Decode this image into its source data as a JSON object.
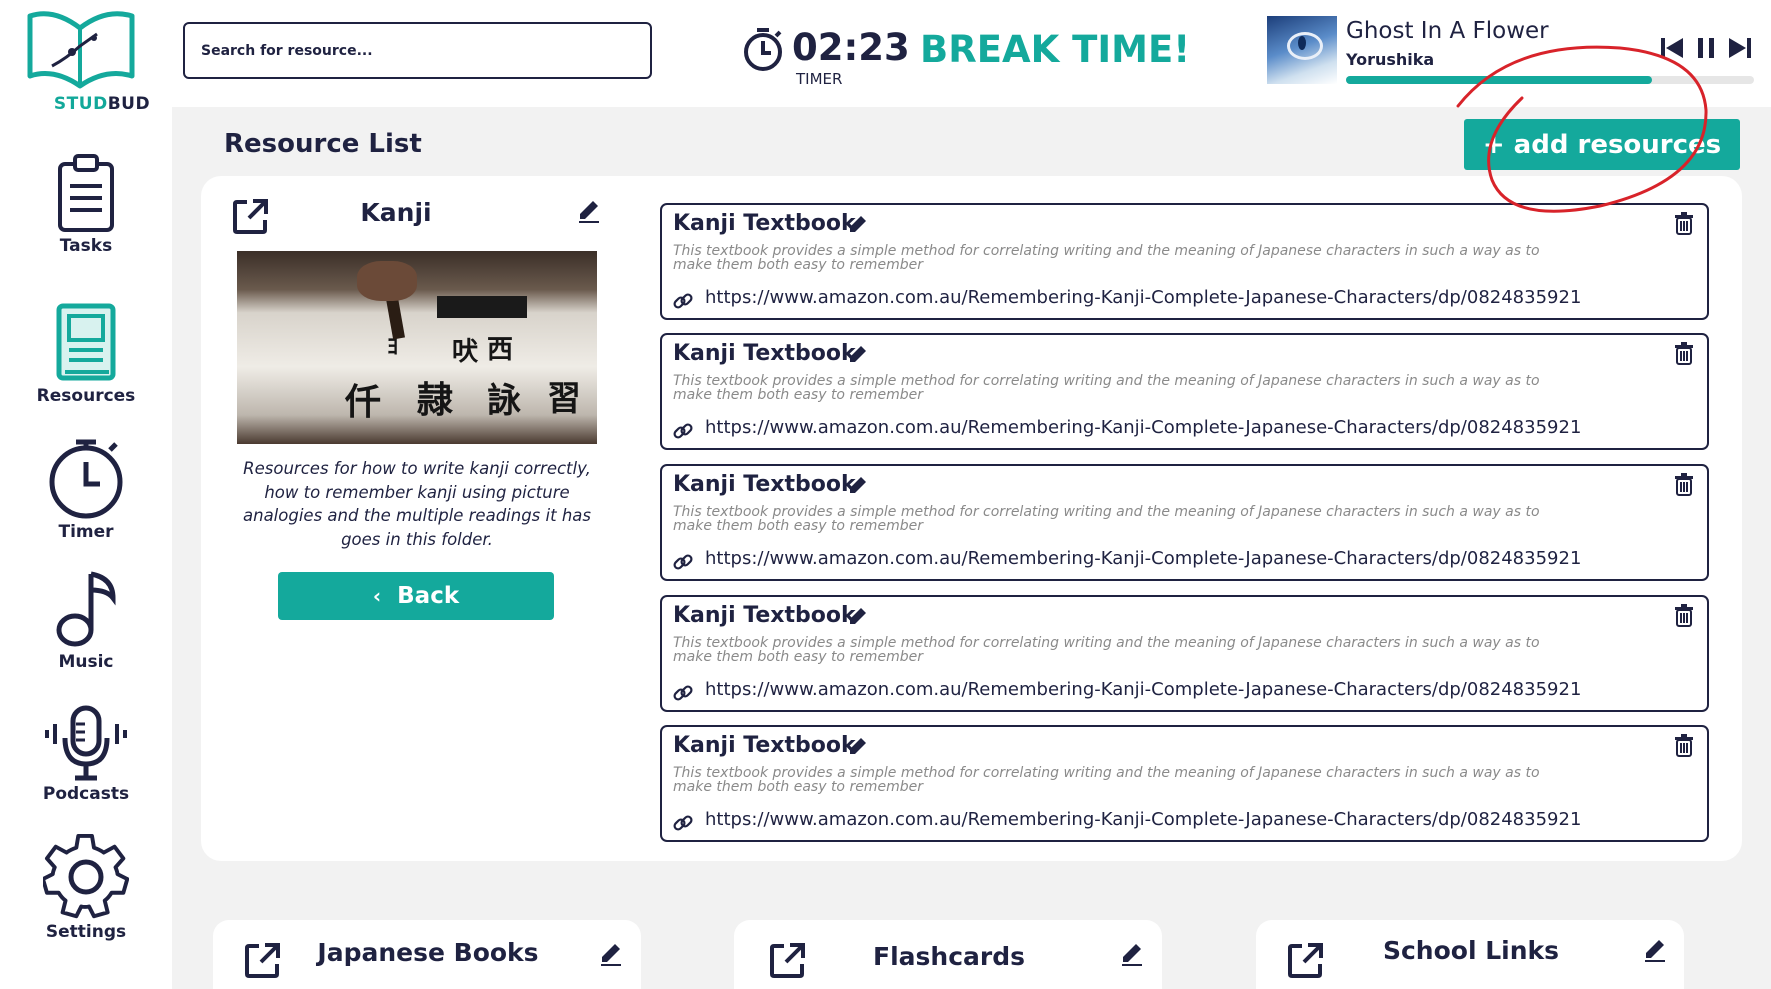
{
  "app": {
    "logo_stud": "STUD",
    "logo_bud": "BUD"
  },
  "sidebar": {
    "items": [
      {
        "label": "Tasks",
        "icon": "clipboard-icon"
      },
      {
        "label": "Resources",
        "icon": "book-icon",
        "active": true
      },
      {
        "label": "Timer",
        "icon": "stopwatch-icon"
      },
      {
        "label": "Music",
        "icon": "music-note-icon"
      },
      {
        "label": "Podcasts",
        "icon": "microphone-icon"
      },
      {
        "label": "Settings",
        "icon": "gear-icon"
      }
    ]
  },
  "header": {
    "search_placeholder": "Search for resource...",
    "timer_value": "02:23",
    "timer_label": "TIMER",
    "status": "BREAK TIME!",
    "player": {
      "song": "Ghost In A Flower",
      "artist": "Yorushika",
      "progress": 0.75
    }
  },
  "page": {
    "title": "Resource List",
    "add_button": "+ add resources"
  },
  "folder": {
    "title": "Kanji",
    "description": "Resources for how to write kanji correctly, how to remember kanji using picture analogies and the multiple readings it has goes in this folder.",
    "back_button": "Back"
  },
  "resources": [
    {
      "title": "Kanji Textbook",
      "description": "This textbook provides a simple method for correlating writing and the meaning of Japanese characters in such a way as to make them both easy to remember",
      "url": "https://www.amazon.com.au/Remembering-Kanji-Complete-Japanese-Characters/dp/0824835921"
    },
    {
      "title": "Kanji Textbook",
      "description": "This textbook provides a simple method for correlating writing and the meaning of Japanese characters in such a way as to make them both easy to remember",
      "url": "https://www.amazon.com.au/Remembering-Kanji-Complete-Japanese-Characters/dp/0824835921"
    },
    {
      "title": "Kanji Textbook",
      "description": "This textbook provides a simple method for correlating writing and the meaning of Japanese characters in such a way as to make them both easy to remember",
      "url": "https://www.amazon.com.au/Remembering-Kanji-Complete-Japanese-Characters/dp/0824835921"
    },
    {
      "title": "Kanji Textbook",
      "description": "This textbook provides a simple method for correlating writing and the meaning of Japanese characters in such a way as to make them both easy to remember",
      "url": "https://www.amazon.com.au/Remembering-Kanji-Complete-Japanese-Characters/dp/0824835921"
    },
    {
      "title": "Kanji Textbook",
      "description": "This textbook provides a simple method for correlating writing and the meaning of Japanese characters in such a way as to make them both easy to remember",
      "url": "https://www.amazon.com.au/Remembering-Kanji-Complete-Japanese-Characters/dp/0824835921"
    }
  ],
  "other_folders": [
    {
      "title": "Japanese Books"
    },
    {
      "title": "Flashcards"
    },
    {
      "title": "School Links"
    }
  ],
  "colors": {
    "accent": "#14a99c",
    "navy": "#1f2241",
    "annotation": "#d8232a",
    "background": "#f2f2f2"
  }
}
